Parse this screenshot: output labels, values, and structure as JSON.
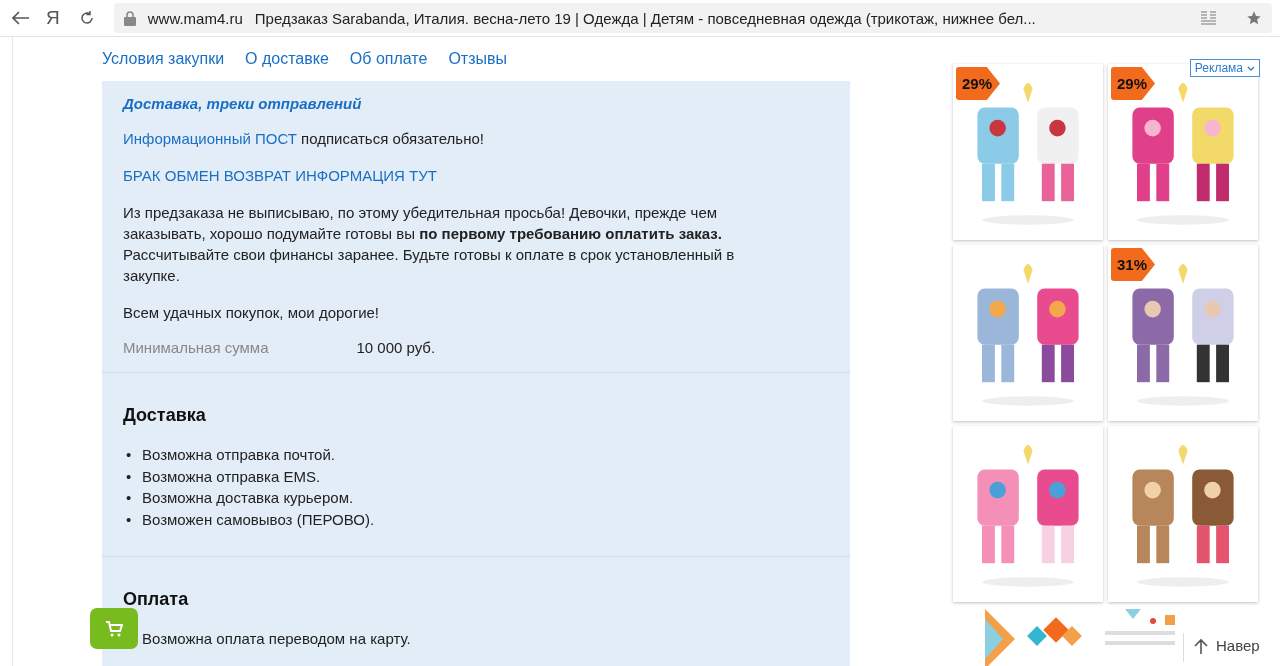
{
  "browser": {
    "logo": "Я",
    "url": "www.mam4.ru",
    "page_title": "Предзаказ Sarabanda, Италия. весна-лето 19 | Одежда | Детям - повседневная одежда (трикотаж, нижнее бел..."
  },
  "nav_links": [
    "Условия закупки",
    "О доставке",
    "Об оплате",
    "Отзывы"
  ],
  "info": {
    "heading": "Доставка, треки отправлений",
    "post": {
      "link": "Информационный ПОСТ",
      "text": " подписаться обязательно!"
    },
    "defects_link": "БРАК ОБМЕН ВОЗВРАТ ИНФОРМАЦИЯ ТУТ",
    "notice": "Из предзаказа не выписываю, по этому убедительная просьба! Девочки, прежде чем заказывать, хорошо подумайте готовы вы **по первому требованию оплатить заказ.** Рассчитывайте свои финансы заранее. Будьте готовы к оплате в срок установленный в закупке.",
    "wishes": "Всем удачных покупок, мои дорогие!",
    "min_sum": {
      "label": "Минимальная сумма",
      "value": "10 000 руб."
    }
  },
  "sections": [
    {
      "title": "Доставка",
      "bullet": "•",
      "items": [
        "Возможна отправка почтой.",
        "Возможна отправка EMS.",
        "Возможна доставка курьером.",
        "Возможен самовывоз (ПЕРОВО)."
      ]
    },
    {
      "title": "Оплата",
      "items": [
        "Возможна оплата переводом на карту."
      ]
    }
  ],
  "ads": {
    "label": "Реклама",
    "products": [
      {
        "kind": "picture",
        "badge": "29%"
      },
      {
        "kind": "picture",
        "badge": "29%"
      },
      {
        "kind": "picture"
      },
      {
        "kind": "picture",
        "badge": "31%"
      },
      {
        "kind": "picture"
      },
      {
        "kind": "picture"
      }
    ],
    "banner": {
      "kind": "picture"
    }
  },
  "scroll_top": "Навер"
}
